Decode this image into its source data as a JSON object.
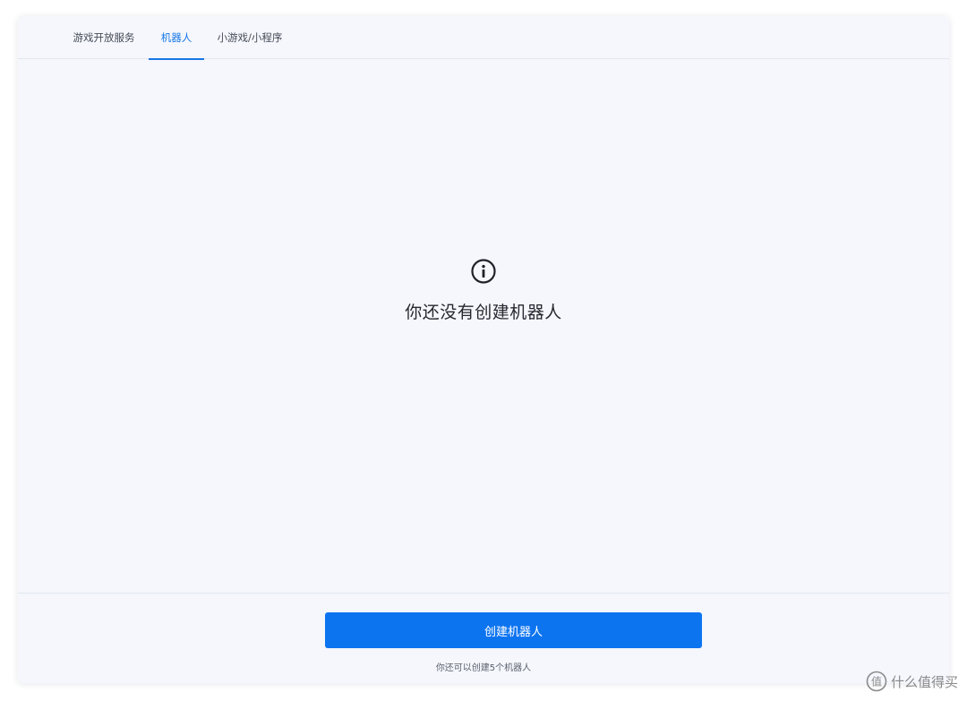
{
  "tabs": [
    {
      "label": "游戏开放服务",
      "active": false
    },
    {
      "label": "机器人",
      "active": true
    },
    {
      "label": "小游戏/小程序",
      "active": false
    }
  ],
  "empty_state": {
    "icon": "info-icon",
    "message": "你还没有创建机器人"
  },
  "footer": {
    "create_button_label": "创建机器人",
    "quota_text": "你还可以创建5个机器人"
  },
  "watermark": {
    "text": "什么值得买"
  },
  "colors": {
    "accent": "#1677e6",
    "button": "#0d74f0",
    "panel_bg": "#f5f7fd"
  }
}
